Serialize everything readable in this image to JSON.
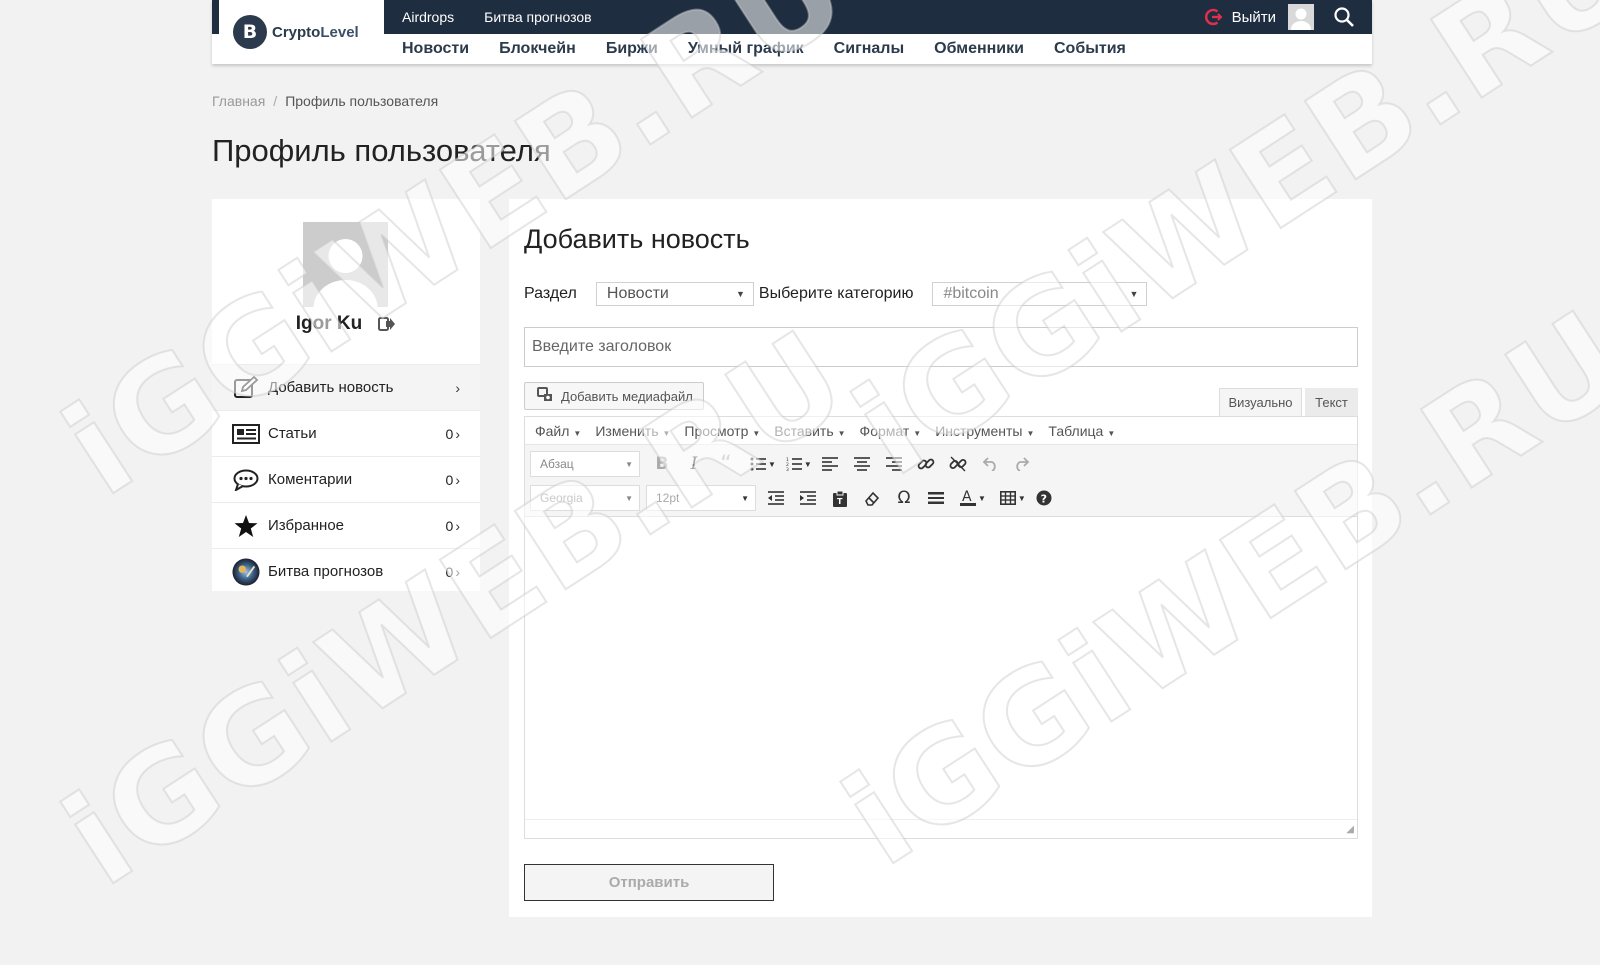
{
  "header": {
    "logo_mark": "B",
    "logo_text_1": "Crypto",
    "logo_text_2": "Level",
    "top_links": [
      "Airdrops",
      "Битва прогнозов"
    ],
    "logout_label": "Выйти",
    "nav": [
      "Новости",
      "Блокчейн",
      "Биржи",
      "Умный график",
      "Сигналы",
      "Обменники",
      "События"
    ]
  },
  "breadcrumb": {
    "home": "Главная",
    "separator": "/",
    "current": "Профиль пользователя"
  },
  "page_title": "Профиль пользователя",
  "profile": {
    "name": "Igor Ku",
    "menu": [
      {
        "label": "Добавить новость",
        "count": "",
        "icon": "edit-icon"
      },
      {
        "label": "Статьи",
        "count": "0",
        "icon": "newspaper-icon"
      },
      {
        "label": "Коментарии",
        "count": "0",
        "icon": "comments-icon"
      },
      {
        "label": "Избранное",
        "count": "0",
        "icon": "star-icon"
      },
      {
        "label": "Битва прогнозов",
        "count": "0",
        "icon": "battle-avatar-icon"
      }
    ],
    "chevron": "›"
  },
  "form": {
    "heading": "Добавить новость",
    "section_label": "Раздел",
    "section_value": "Новости",
    "category_label": "Выберите категорию",
    "category_value": "#bitcoin",
    "title_placeholder": "Введите заголовок",
    "media_button": "Добавить медиафайл",
    "tab_visual": "Визуально",
    "tab_text": "Текст",
    "submit": "Отправить"
  },
  "editor": {
    "menus": [
      "Файл",
      "Изменить",
      "Просмотр",
      "Вставить",
      "Формат",
      "Инструменты",
      "Таблица"
    ],
    "format_select": "Абзац",
    "font_select": "Georgia",
    "size_select": "12pt"
  },
  "watermark": "iGGiWEB.RU",
  "colors": {
    "topbar": "#1e2d3f",
    "logout_accent": "#e0304e",
    "page_bg": "#f2f2f2"
  }
}
